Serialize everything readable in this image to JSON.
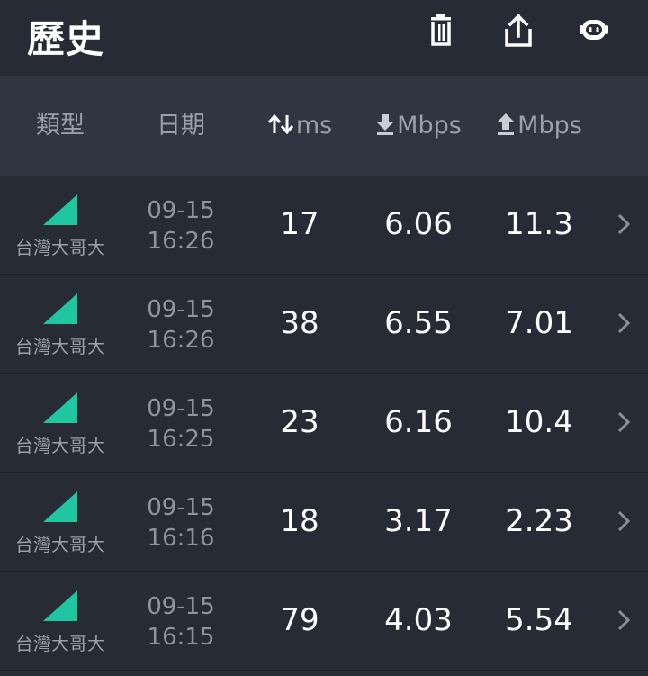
{
  "header": {
    "title": "歷史",
    "icons": [
      "trash-icon",
      "share-icon",
      "robot-icon"
    ]
  },
  "columns": {
    "type": "類型",
    "date": "日期",
    "latency": "ms",
    "download": "Mbps",
    "upload": "Mbps"
  },
  "colors": {
    "background": "#262b36",
    "header_bg": "#303542",
    "signal": "#1fc6a0",
    "muted_text": "#9aa0aa"
  },
  "rows": [
    {
      "carrier": "台灣大哥大",
      "date": "09-15",
      "time": "16:26",
      "ms": "17",
      "down": "6.06",
      "up": "11.3"
    },
    {
      "carrier": "台灣大哥大",
      "date": "09-15",
      "time": "16:26",
      "ms": "38",
      "down": "6.55",
      "up": "7.01"
    },
    {
      "carrier": "台灣大哥大",
      "date": "09-15",
      "time": "16:25",
      "ms": "23",
      "down": "6.16",
      "up": "10.4"
    },
    {
      "carrier": "台灣大哥大",
      "date": "09-15",
      "time": "16:16",
      "ms": "18",
      "down": "3.17",
      "up": "2.23"
    },
    {
      "carrier": "台灣大哥大",
      "date": "09-15",
      "time": "16:15",
      "ms": "79",
      "down": "4.03",
      "up": "5.54"
    }
  ]
}
